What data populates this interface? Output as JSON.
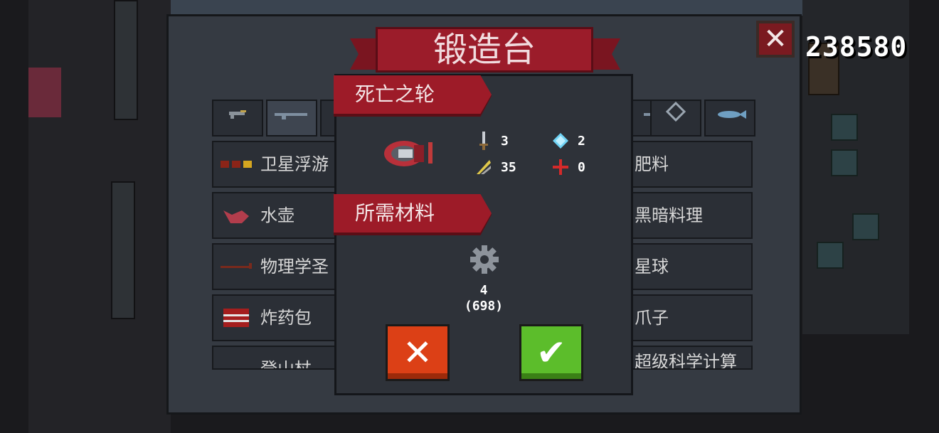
{
  "forge": {
    "title": "锻造台",
    "close_label": "✕",
    "score": "238580",
    "tabs": [
      {
        "name": "pistol-tab-icon"
      },
      {
        "name": "rifle-tab-icon"
      },
      {
        "name": "weapon-tab-icon-3"
      },
      {
        "name": "weapon-tab-icon-4"
      },
      {
        "name": "crosshair-tab-icon"
      },
      {
        "name": "fish-tab-icon"
      }
    ],
    "left_items": [
      "卫星浮游",
      "水壶",
      "物理学圣",
      "炸药包",
      "登山杖"
    ],
    "right_items": [
      "肥料",
      "黑暗料理",
      "星球",
      "爪子",
      "超级科学计算"
    ]
  },
  "dialog": {
    "weapon_name": "死亡之轮",
    "stats": {
      "attack": "3",
      "energy": "2",
      "crit": "35",
      "precision": "0"
    },
    "materials_title": "所需材料",
    "material": {
      "icon": "gear-icon",
      "required": "4",
      "owned": "(698)"
    },
    "cancel_label": "✕",
    "confirm_label": "✔"
  },
  "colors": {
    "ribbon": "#9d1b28",
    "cancel": "#dc4016",
    "confirm": "#5cbd2b"
  }
}
